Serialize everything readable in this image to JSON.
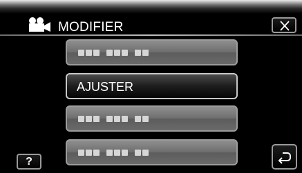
{
  "header": {
    "title": "MODIFIER",
    "mode_icon": "video-camera-icon",
    "close_icon": "close-icon"
  },
  "menu": {
    "items": [
      {
        "label": "",
        "state": "blank-placeholder"
      },
      {
        "label": "AJUSTER",
        "state": "selected"
      },
      {
        "label": "",
        "state": "blank-placeholder"
      },
      {
        "label": "",
        "state": "blank-placeholder"
      }
    ]
  },
  "footer": {
    "help_label": "?",
    "back_icon": "return-arrow-icon"
  },
  "colors": {
    "background": "#000000",
    "button_gray": "#6f6f6f",
    "button_border": "#9c9c9c",
    "text": "#ffffff"
  }
}
